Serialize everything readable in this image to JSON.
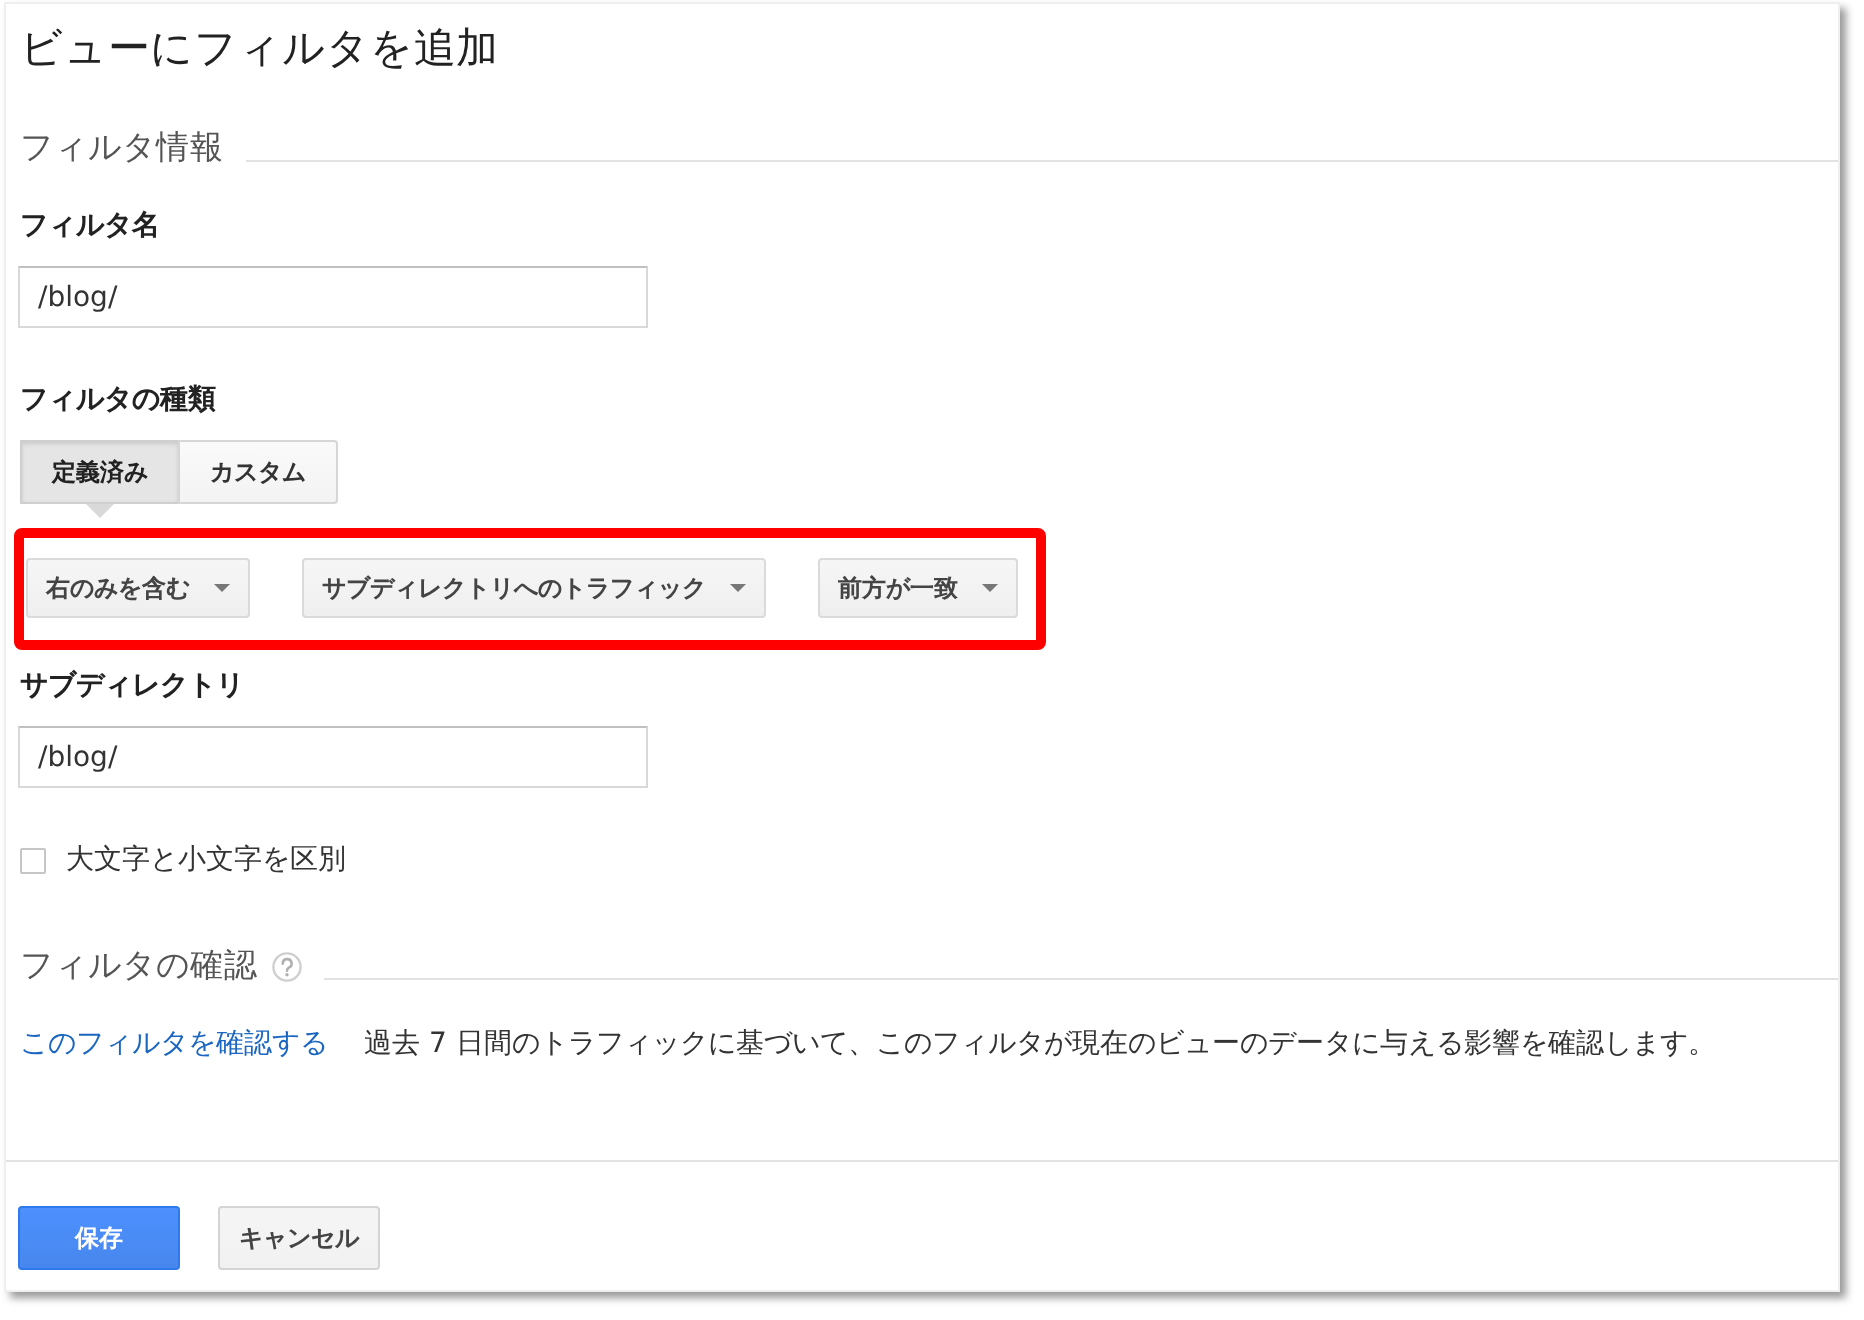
{
  "title": "ビューにフィルタを追加",
  "filter_info": {
    "heading": "フィルタ情報",
    "filter_name": {
      "label": "フィルタ名",
      "value": "/blog/"
    },
    "filter_type": {
      "label": "フィルタの種類",
      "tabs": [
        {
          "label": "定義済み",
          "selected": true
        },
        {
          "label": "カスタム",
          "selected": false
        }
      ]
    },
    "predefined": {
      "highlighted": true,
      "dropdowns": [
        {
          "value": "右のみを含む"
        },
        {
          "value": "サブディレクトリへのトラフィック"
        },
        {
          "value": "前方が一致"
        }
      ]
    },
    "subdirectory": {
      "label": "サブディレクトリ",
      "value": "/blog/"
    },
    "case_sensitive": {
      "label": "大文字と小文字を区別",
      "checked": false
    }
  },
  "verification": {
    "heading": "フィルタの確認",
    "link": "このフィルタを確認する",
    "description": "過去 7 日間のトラフィックに基づいて、このフィルタが現在のビューのデータに与える影響を確認します。"
  },
  "buttons": [
    {
      "label": "保存",
      "kind": "primary"
    },
    {
      "label": "キャンセル",
      "kind": "secondary"
    }
  ]
}
